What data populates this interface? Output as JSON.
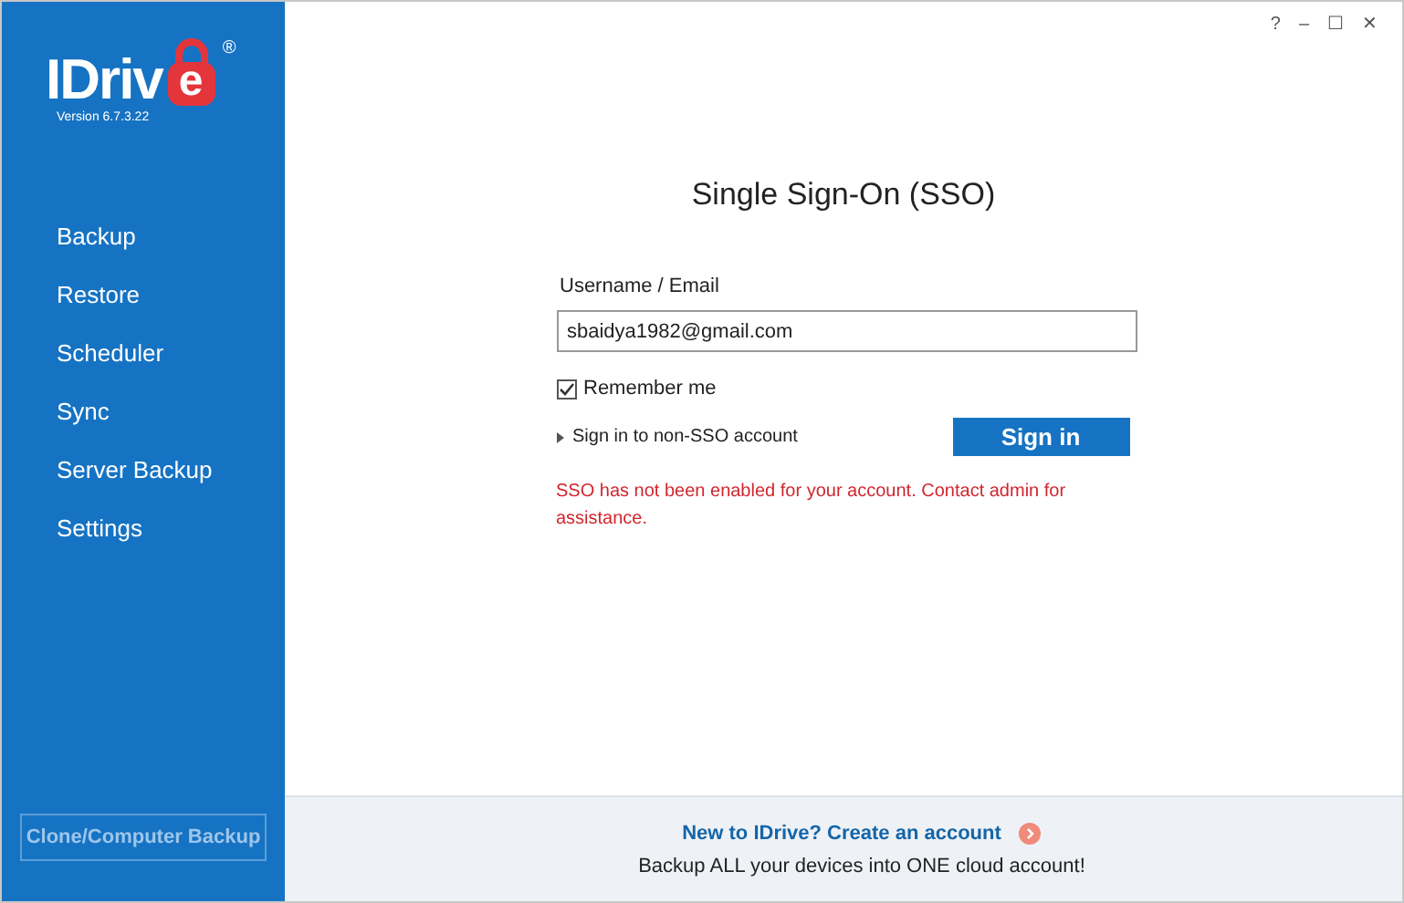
{
  "logo": {
    "text": "IDriv",
    "badge_letter": "e",
    "registered": "®",
    "version": "Version  6.7.3.22"
  },
  "window_controls": [
    "?",
    "–",
    "☐",
    "✕"
  ],
  "sidebar": {
    "items": [
      {
        "label": "Backup"
      },
      {
        "label": "Restore"
      },
      {
        "label": "Scheduler"
      },
      {
        "label": "Sync"
      },
      {
        "label": "Server Backup"
      },
      {
        "label": "Settings"
      }
    ],
    "bottom_button": "Clone/Computer Backup"
  },
  "form": {
    "title": "Single Sign-On (SSO)",
    "username_label": "Username / Email",
    "username_value": "sbaidya1982@gmail.com",
    "remember": {
      "label": "Remember me",
      "checked": true
    },
    "non_sso_link": "Sign in to non-SSO account",
    "sign_in_button": "Sign in",
    "error": "SSO has not been enabled for your account. Contact admin for assistance."
  },
  "footer": {
    "link": "New to IDrive? Create an account",
    "tagline": "Backup ALL your devices into ONE cloud account!"
  }
}
